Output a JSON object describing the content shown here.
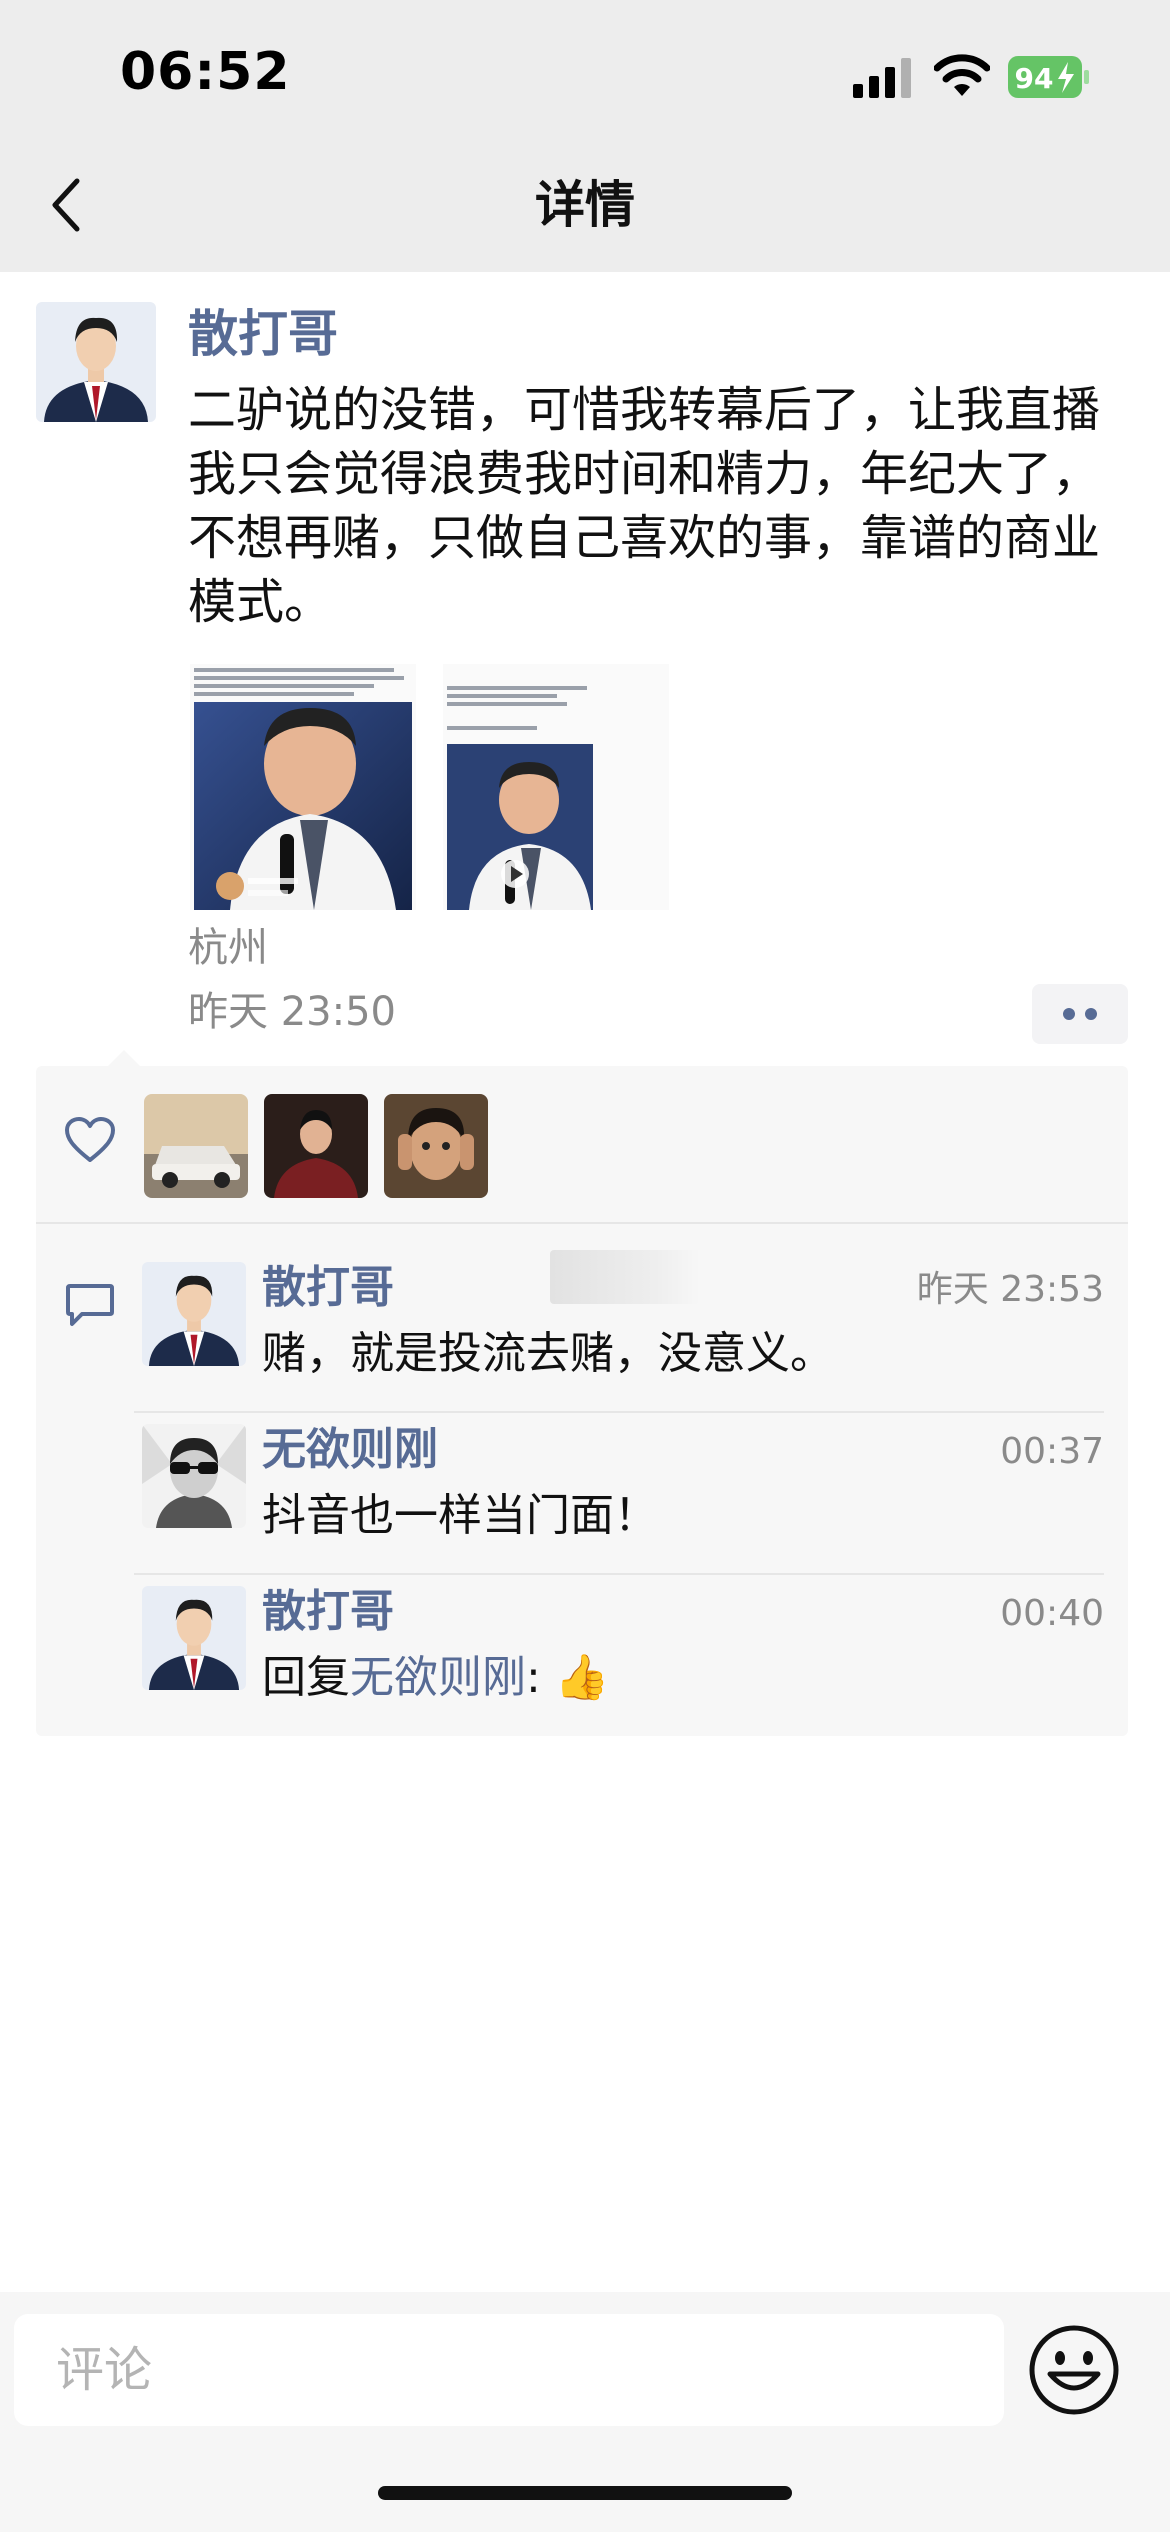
{
  "status_bar": {
    "time": "06:52",
    "battery": "94"
  },
  "nav": {
    "title": "详情",
    "back_icon": "chevron-left-icon"
  },
  "post": {
    "author": "散打哥",
    "text": "二驴说的没错，可惜我转幕后了，让我直播我只会觉得浪费我时间和精力，年纪大了，不想再赌，只做自己喜欢的事，靠谱的商业模式。",
    "images": [
      {
        "description": "screenshot-thumbnail-1"
      },
      {
        "description": "screenshot-thumbnail-2"
      }
    ],
    "location": "杭州",
    "time": "昨天 23:50"
  },
  "likes": {
    "icon": "heart-icon",
    "count_shown": 3
  },
  "comments": [
    {
      "name": "散打哥",
      "time": "昨天 23:53",
      "text": "赌，就是投流去赌，没意义。"
    },
    {
      "name": "无欲则刚",
      "time": "00:37",
      "text": "抖音也一样当门面！"
    },
    {
      "name": "散打哥",
      "time": "00:40",
      "reply_prefix": "回复",
      "reply_to": "无欲则刚",
      "reply_sep": ":",
      "text": "👍"
    }
  ],
  "input": {
    "placeholder": "评论"
  },
  "colors": {
    "link": "#576b95",
    "battery": "#65c466",
    "panel": "#f7f7f7",
    "topbar": "#ededed"
  }
}
